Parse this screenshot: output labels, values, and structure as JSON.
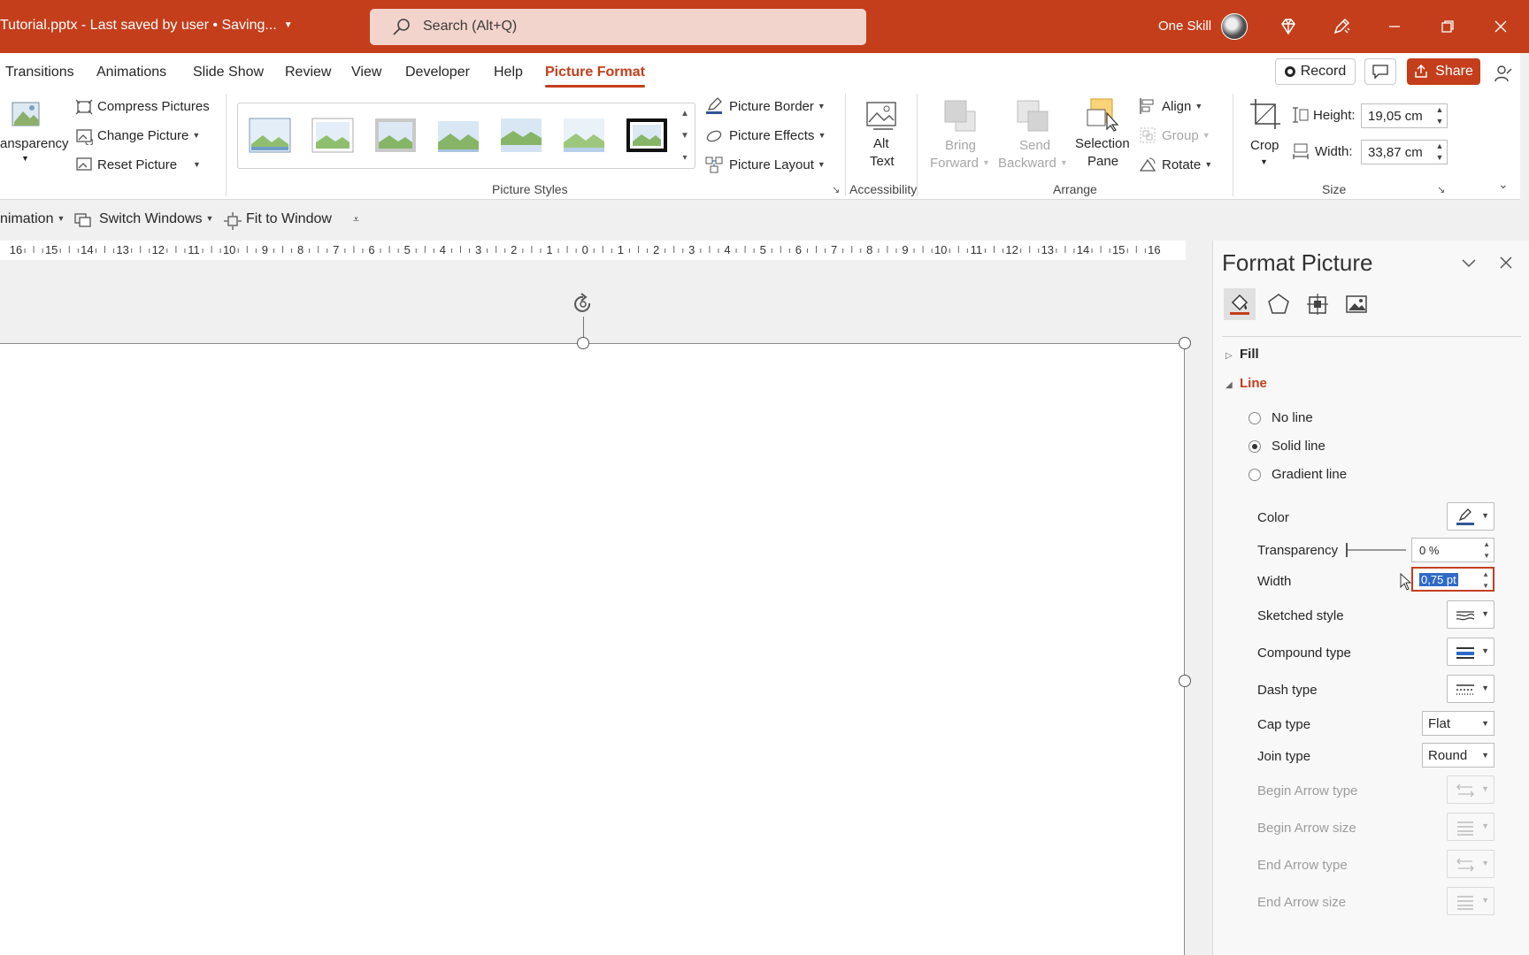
{
  "titlebar": {
    "doc_title": "Tutorial.pptx  -  Last saved by user • Saving...",
    "search_placeholder": "Search (Alt+Q)",
    "account_name": "One Skill"
  },
  "tabs": [
    "Transitions",
    "Animations",
    "Slide Show",
    "Review",
    "View",
    "Developer",
    "Help",
    "Picture Format"
  ],
  "active_tab": "Picture Format",
  "header_actions": {
    "record": "Record",
    "share": "Share"
  },
  "ribbon": {
    "adjust": {
      "transparency": "ansparency",
      "compress": "Compress Pictures",
      "change": "Change Picture",
      "reset": "Reset Picture"
    },
    "picture_styles": {
      "label": "Picture Styles",
      "border": "Picture Border",
      "effects": "Picture Effects",
      "layout": "Picture Layout"
    },
    "accessibility": {
      "alt_line1": "Alt",
      "alt_line2": "Text",
      "label": "Accessibility"
    },
    "arrange": {
      "bring_line1": "Bring",
      "bring_line2": "Forward",
      "send_line1": "Send",
      "send_line2": "Backward",
      "selection_line1": "Selection",
      "selection_line2": "Pane",
      "align": "Align",
      "group": "Group",
      "rotate": "Rotate",
      "label": "Arrange"
    },
    "size": {
      "crop": "Crop",
      "height_label": "Height:",
      "height_value": "19,05 cm",
      "width_label": "Width:",
      "width_value": "33,87 cm",
      "label": "Size"
    }
  },
  "qat": {
    "animation": "nimation",
    "switch_windows": "Switch Windows",
    "fit_to_window": "Fit to Window"
  },
  "ruler_ticks": [
    "16",
    "15",
    "14",
    "13",
    "12",
    "11",
    "10",
    "9",
    "8",
    "7",
    "6",
    "5",
    "4",
    "3",
    "2",
    "1",
    "0",
    "1",
    "2",
    "3",
    "4",
    "5",
    "6",
    "7",
    "8",
    "9",
    "10",
    "11",
    "12",
    "13",
    "14",
    "15",
    "16"
  ],
  "pane": {
    "title": "Format Picture",
    "sections": {
      "fill": "Fill",
      "line": "Line"
    },
    "line_options": [
      "No line",
      "Solid line",
      "Gradient line"
    ],
    "selected_line_option": "Solid line",
    "props": {
      "color": "Color",
      "transparency": "Transparency",
      "transparency_value": "0 %",
      "width": "Width",
      "width_value": "0,75 pt",
      "sketched": "Sketched style",
      "compound": "Compound type",
      "dash": "Dash type",
      "cap": "Cap type",
      "cap_value": "Flat",
      "join": "Join type",
      "join_value": "Round",
      "begin_arrow_type": "Begin Arrow type",
      "begin_arrow_size": "Begin Arrow size",
      "end_arrow_type": "End Arrow type",
      "end_arrow_size": "End Arrow size"
    }
  },
  "colors": {
    "brand": "#c43e1c",
    "search_bg": "#f3d4cc",
    "selection": "#2f6ac7"
  }
}
